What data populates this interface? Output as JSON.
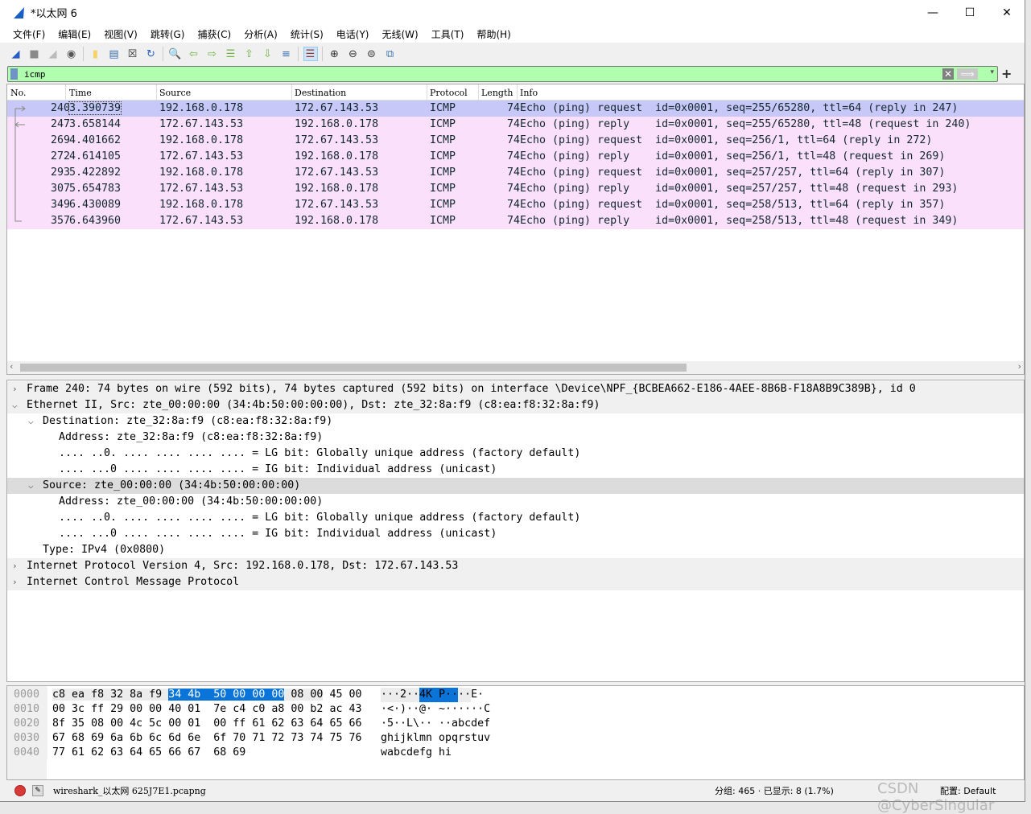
{
  "window": {
    "title": "*以太网 6",
    "minimize": "—",
    "maximize": "☐",
    "close": "✕"
  },
  "menu": [
    "文件(F)",
    "编辑(E)",
    "视图(V)",
    "跳转(G)",
    "捕获(C)",
    "分析(A)",
    "统计(S)",
    "电话(Y)",
    "无线(W)",
    "工具(T)",
    "帮助(H)"
  ],
  "toolbar": [
    {
      "name": "start-capture-icon",
      "glyph": "◢",
      "color": "#2a5fc0"
    },
    {
      "name": "stop-capture-icon",
      "glyph": "■",
      "color": "#8a8a8a"
    },
    {
      "name": "restart-capture-icon",
      "glyph": "◢",
      "color": "#bbbbbb"
    },
    {
      "name": "capture-options-icon",
      "glyph": "◉",
      "color": "#555555"
    },
    {
      "sep": true
    },
    {
      "name": "open-file-icon",
      "glyph": "▮",
      "color": "#f5d36a"
    },
    {
      "name": "save-file-icon",
      "glyph": "▤",
      "color": "#3a6fb0"
    },
    {
      "name": "close-file-icon",
      "glyph": "☒",
      "color": "#333333"
    },
    {
      "name": "reload-file-icon",
      "glyph": "↻",
      "color": "#2a5fc0"
    },
    {
      "sep": true
    },
    {
      "name": "find-packet-icon",
      "glyph": "🔍",
      "color": "#333333"
    },
    {
      "name": "go-back-icon",
      "glyph": "⇦",
      "color": "#6cb33f"
    },
    {
      "name": "go-forward-icon",
      "glyph": "⇨",
      "color": "#6cb33f"
    },
    {
      "name": "go-to-packet-icon",
      "glyph": "☰",
      "color": "#6cb33f"
    },
    {
      "name": "first-packet-icon",
      "glyph": "⇧",
      "color": "#6cb33f"
    },
    {
      "name": "last-packet-icon",
      "glyph": "⇩",
      "color": "#6cb33f"
    },
    {
      "name": "autoscroll-icon",
      "glyph": "≡",
      "color": "#3a6fb0"
    },
    {
      "sep": true
    },
    {
      "name": "colorize-icon",
      "glyph": "☰",
      "color": "#a03030",
      "active": true
    },
    {
      "sep": true
    },
    {
      "name": "zoom-in-icon",
      "glyph": "⊕",
      "color": "#333333"
    },
    {
      "name": "zoom-out-icon",
      "glyph": "⊖",
      "color": "#333333"
    },
    {
      "name": "zoom-reset-icon",
      "glyph": "⊜",
      "color": "#333333"
    },
    {
      "name": "resize-columns-icon",
      "glyph": "⧉",
      "color": "#3a6fb0"
    }
  ],
  "filter": {
    "value": "icmp",
    "clear": "✕",
    "apply": "⟹",
    "dropdown": "▾",
    "add": "+",
    "bg_color": "#afffaf"
  },
  "packet_list": {
    "columns": [
      "No.",
      "Time",
      "Source",
      "Destination",
      "Protocol",
      "Length",
      "Info"
    ],
    "rows": [
      {
        "no": "240",
        "time": "3.390739",
        "src": "192.168.0.178",
        "dst": "172.67.143.53",
        "proto": "ICMP",
        "len": "74",
        "info": "Echo (ping) request  id=0x0001, seq=255/65280, ttl=64 (reply in 247)",
        "selected": true
      },
      {
        "no": "247",
        "time": "3.658144",
        "src": "172.67.143.53",
        "dst": "192.168.0.178",
        "proto": "ICMP",
        "len": "74",
        "info": "Echo (ping) reply    id=0x0001, seq=255/65280, ttl=48 (request in 240)"
      },
      {
        "no": "269",
        "time": "4.401662",
        "src": "192.168.0.178",
        "dst": "172.67.143.53",
        "proto": "ICMP",
        "len": "74",
        "info": "Echo (ping) request  id=0x0001, seq=256/1, ttl=64 (reply in 272)"
      },
      {
        "no": "272",
        "time": "4.614105",
        "src": "172.67.143.53",
        "dst": "192.168.0.178",
        "proto": "ICMP",
        "len": "74",
        "info": "Echo (ping) reply    id=0x0001, seq=256/1, ttl=48 (request in 269)"
      },
      {
        "no": "293",
        "time": "5.422892",
        "src": "192.168.0.178",
        "dst": "172.67.143.53",
        "proto": "ICMP",
        "len": "74",
        "info": "Echo (ping) request  id=0x0001, seq=257/257, ttl=64 (reply in 307)"
      },
      {
        "no": "307",
        "time": "5.654783",
        "src": "172.67.143.53",
        "dst": "192.168.0.178",
        "proto": "ICMP",
        "len": "74",
        "info": "Echo (ping) reply    id=0x0001, seq=257/257, ttl=48 (request in 293)"
      },
      {
        "no": "349",
        "time": "6.430089",
        "src": "192.168.0.178",
        "dst": "172.67.143.53",
        "proto": "ICMP",
        "len": "74",
        "info": "Echo (ping) request  id=0x0001, seq=258/513, ttl=64 (reply in 357)"
      },
      {
        "no": "357",
        "time": "6.643960",
        "src": "172.67.143.53",
        "dst": "192.168.0.178",
        "proto": "ICMP",
        "len": "74",
        "info": "Echo (ping) reply    id=0x0001, seq=258/513, ttl=48 (request in 349)"
      }
    ],
    "row_color": "#fae0fa",
    "selected_color": "#c8c8f8"
  },
  "details": [
    {
      "level": 0,
      "expander": ">",
      "text": "Frame 240: 74 bytes on wire (592 bits), 74 bytes captured (592 bits) on interface \\Device\\NPF_{BCBEA662-E186-4AEE-8B6B-F18A8B9C389B}, id 0"
    },
    {
      "level": 0,
      "expander": "v",
      "text": "Ethernet II, Src: zte_00:00:00 (34:4b:50:00:00:00), Dst: zte_32:8a:f9 (c8:ea:f8:32:8a:f9)"
    },
    {
      "level": 1,
      "expander": "v",
      "text": "Destination: zte_32:8a:f9 (c8:ea:f8:32:8a:f9)"
    },
    {
      "level": 2,
      "expander": "",
      "text": "Address: zte_32:8a:f9 (c8:ea:f8:32:8a:f9)"
    },
    {
      "level": 2,
      "expander": "",
      "text": ".... ..0. .... .... .... .... = LG bit: Globally unique address (factory default)"
    },
    {
      "level": 2,
      "expander": "",
      "text": ".... ...0 .... .... .... .... = IG bit: Individual address (unicast)"
    },
    {
      "level": 1,
      "expander": "v",
      "text": "Source: zte_00:00:00 (34:4b:50:00:00:00)",
      "selected": true
    },
    {
      "level": 2,
      "expander": "",
      "text": "Address: zte_00:00:00 (34:4b:50:00:00:00)"
    },
    {
      "level": 2,
      "expander": "",
      "text": ".... ..0. .... .... .... .... = LG bit: Globally unique address (factory default)"
    },
    {
      "level": 2,
      "expander": "",
      "text": ".... ...0 .... .... .... .... = IG bit: Individual address (unicast)"
    },
    {
      "level": 1,
      "expander": "",
      "text": "Type: IPv4 (0x0800)"
    },
    {
      "level": 0,
      "expander": ">",
      "text": "Internet Protocol Version 4, Src: 192.168.0.178, Dst: 172.67.143.53"
    },
    {
      "level": 0,
      "expander": ">",
      "text": "Internet Control Message Protocol"
    }
  ],
  "bytes": [
    {
      "offset": "0000",
      "hex": [
        "c8",
        "ea",
        "f8",
        "32",
        "8a",
        "f9",
        "34",
        "4b",
        "50",
        "00",
        "00",
        "00",
        "08",
        "00",
        "45",
        "00"
      ],
      "ascii": "···2··4K P····E·"
    },
    {
      "offset": "0010",
      "hex": [
        "00",
        "3c",
        "ff",
        "29",
        "00",
        "00",
        "40",
        "01",
        "7e",
        "c4",
        "c0",
        "a8",
        "00",
        "b2",
        "ac",
        "43"
      ],
      "ascii": "·<·)··@· ~······C"
    },
    {
      "offset": "0020",
      "hex": [
        "8f",
        "35",
        "08",
        "00",
        "4c",
        "5c",
        "00",
        "01",
        "00",
        "ff",
        "61",
        "62",
        "63",
        "64",
        "65",
        "66"
      ],
      "ascii": "·5··L\\·· ··abcdef"
    },
    {
      "offset": "0030",
      "hex": [
        "67",
        "68",
        "69",
        "6a",
        "6b",
        "6c",
        "6d",
        "6e",
        "6f",
        "70",
        "71",
        "72",
        "73",
        "74",
        "75",
        "76"
      ],
      "ascii": "ghijklmn opqrstuv"
    },
    {
      "offset": "0040",
      "hex": [
        "77",
        "61",
        "62",
        "63",
        "64",
        "65",
        "66",
        "67",
        "68",
        "69"
      ],
      "ascii": "wabcdefg hi"
    }
  ],
  "status": {
    "file": "wireshark_以太网 625J7E1.pcapng",
    "packets": "分组: 465 · 已显示: 8 (1.7%)",
    "profile": "配置: Default"
  },
  "watermark": "CSDN @CyberSingular"
}
